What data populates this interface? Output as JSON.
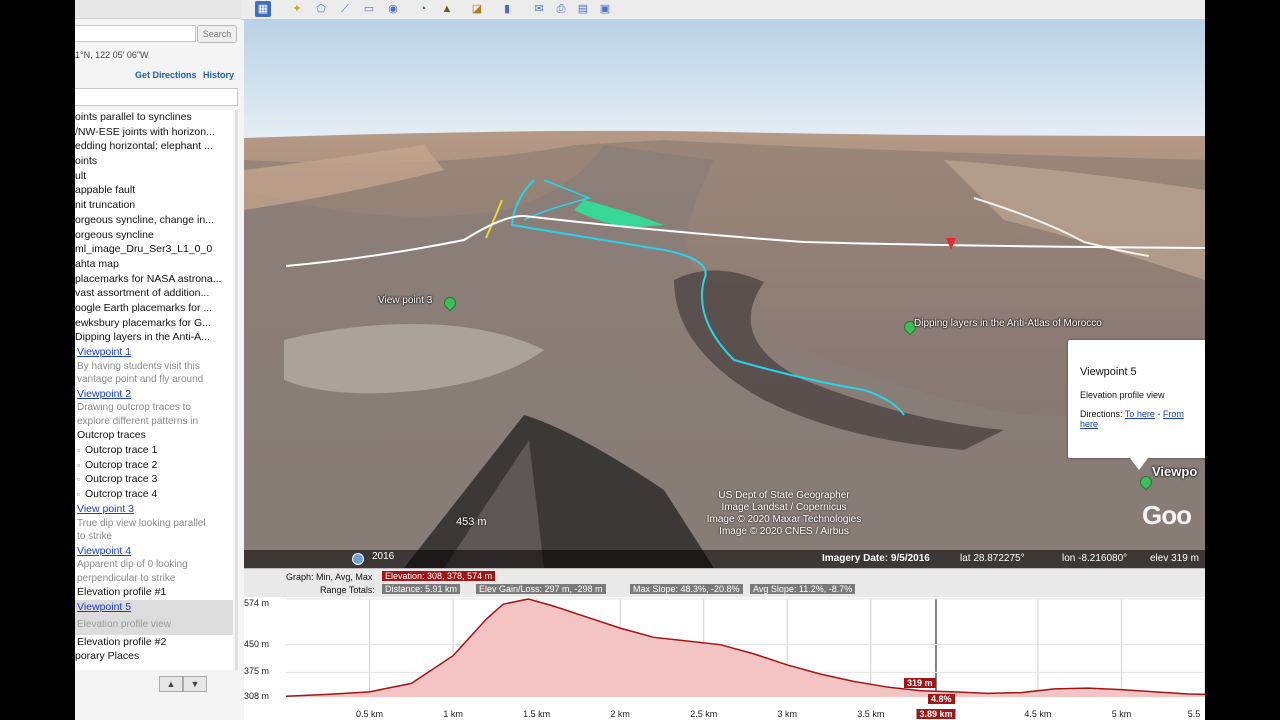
{
  "panel": {
    "search_value": "",
    "search_button": "Search",
    "coords": "1°N, 122 05' 06\"W",
    "get_directions": "Get Directions",
    "history": "History",
    "items": [
      {
        "label": "oints parallel to synclines",
        "kind": "plain"
      },
      {
        "label": "/NW-ESE joints with horizon...",
        "kind": "plain"
      },
      {
        "label": "edding horizontal; elephant ...",
        "kind": "plain"
      },
      {
        "label": "oints",
        "kind": "plain"
      },
      {
        "label": "ult",
        "kind": "plain"
      },
      {
        "label": "appable fault",
        "kind": "plain"
      },
      {
        "label": "nit truncation",
        "kind": "plain"
      },
      {
        "label": "orgeous syncline, change in...",
        "kind": "plain"
      },
      {
        "label": "orgeous syncline",
        "kind": "plain"
      },
      {
        "label": "ml_image_Dru_Ser3_L1_0_0",
        "kind": "plain"
      },
      {
        "label": "ahta map",
        "kind": "plain"
      },
      {
        "label": "placemarks for NASA astrona...",
        "kind": "plain"
      },
      {
        "label": "vast assortment of addition...",
        "kind": "plain"
      },
      {
        "label": "oogle Earth placemarks for ...",
        "kind": "plain"
      },
      {
        "label": "ewksbury placemarks for G...",
        "kind": "plain"
      },
      {
        "label": "Dipping layers in the Anti-A...",
        "kind": "plain"
      },
      {
        "label": "Viewpoint 1",
        "kind": "link"
      },
      {
        "label": "By having students visit this",
        "kind": "desc"
      },
      {
        "label": "vantage point and fly around",
        "kind": "desc"
      },
      {
        "label": "Viewpoint 2",
        "kind": "link"
      },
      {
        "label": "Drawing outcrop traces to",
        "kind": "desc"
      },
      {
        "label": "explore different patterns in",
        "kind": "desc"
      },
      {
        "label": "Outcrop traces",
        "kind": "ind"
      },
      {
        "label": "Outcrop trace 1",
        "kind": "trace"
      },
      {
        "label": "Outcrop trace 2",
        "kind": "trace"
      },
      {
        "label": "Outcrop trace 3",
        "kind": "trace"
      },
      {
        "label": "Outcrop trace 4",
        "kind": "trace"
      },
      {
        "label": "View point 3",
        "kind": "link"
      },
      {
        "label": "True dip view looking parallel",
        "kind": "desc"
      },
      {
        "label": "to strike",
        "kind": "desc"
      },
      {
        "label": "Viewpoint 4",
        "kind": "link"
      },
      {
        "label": "Apparent dip of 0 looking",
        "kind": "desc"
      },
      {
        "label": "perpendicular to strike",
        "kind": "desc"
      },
      {
        "label": "Elevation profile #1",
        "kind": "ind"
      },
      {
        "label": "Viewpoint 5",
        "kind": "sel"
      },
      {
        "label": "Elevation profile view",
        "kind": "sel-desc"
      },
      {
        "label": "Elevation profile #2",
        "kind": "ind"
      },
      {
        "label": "porary Places",
        "kind": "plain"
      }
    ]
  },
  "map": {
    "attribution": [
      "US Dept of State Geographer",
      "Image Landsat / Copernicus",
      "Image © 2020 Maxar Technologies",
      "Image © 2020 CNES / Airbus"
    ],
    "imagery_date": "Imagery Date: 9/5/2016",
    "lat": "lat  28.872275°",
    "lon": "lon  -8.216080°",
    "elev": "elev  319 m",
    "year": "2016",
    "scale": "453 m",
    "watermark": "Goo",
    "label_viewpoint3": "View point 3",
    "label_dipping": "Dipping layers in the Anti-Atlas of Morocco",
    "label_viewpoint_edge": "Viewpo",
    "balloon": {
      "title": "Viewpoint 5",
      "subtitle": "Elevation profile view",
      "directions_prefix": "Directions: ",
      "to_here": "To here",
      "sep": " - ",
      "from": "From",
      "here": "here"
    }
  },
  "profile": {
    "graph_label": "Graph: Min, Avg, Max",
    "elevation": "Elevation: 308, 378, 574 m",
    "range_label": "Range Totals:",
    "distance": "Distance: 5.91 km",
    "gain": "Elev Gain/Loss: 297 m, -298 m",
    "max_slope": "Max Slope: 48.3%, -20.8%",
    "avg_slope": "Avg Slope: 11.2%, -8.7%",
    "yticks": [
      "574 m",
      "450 m",
      "375 m",
      "308 m"
    ],
    "xticks": [
      "0.5 km",
      "1 km",
      "1.5 km",
      "2 km",
      "2.5 km",
      "3 km",
      "3.5 km",
      "3.89 km",
      "4.5 km",
      "5 km",
      "5.5"
    ],
    "marker_elev": "319 m",
    "marker_slope": "4.8%",
    "accent": "#a31515"
  },
  "chart_data": {
    "type": "area",
    "title": "",
    "xlabel": "",
    "ylabel": "",
    "ylim": [
      308,
      574
    ],
    "x": [
      0,
      0.25,
      0.5,
      0.75,
      1.0,
      1.1,
      1.2,
      1.3,
      1.45,
      1.6,
      1.8,
      2.0,
      2.2,
      2.4,
      2.6,
      2.8,
      3.0,
      3.2,
      3.4,
      3.6,
      3.8,
      4.0,
      4.2,
      4.4,
      4.6,
      4.8,
      5.0,
      5.2,
      5.4,
      5.6,
      5.8,
      5.91
    ],
    "values": [
      310,
      315,
      322,
      345,
      420,
      470,
      520,
      560,
      574,
      555,
      525,
      495,
      470,
      460,
      450,
      425,
      395,
      370,
      350,
      335,
      325,
      322,
      318,
      320,
      330,
      332,
      328,
      322,
      316,
      314,
      312,
      310
    ]
  }
}
